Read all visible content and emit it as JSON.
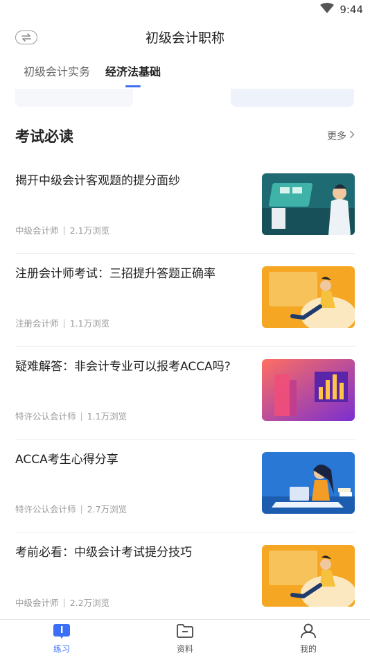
{
  "status": {
    "time": "9:44"
  },
  "header": {
    "title": "初级会计职称"
  },
  "tabs": [
    {
      "label": "初级会计实务",
      "active": false
    },
    {
      "label": "经济法基础",
      "active": true
    }
  ],
  "section": {
    "title": "考试必读",
    "more_label": "更多"
  },
  "articles": [
    {
      "title": "揭开中级会计客观题的提分面纱",
      "category": "中级会计师",
      "views": "2.1万浏览",
      "thumb": "tech"
    },
    {
      "title": "注册会计师考试：三招提升答题正确率",
      "category": "注册会计师",
      "views": "1.1万浏览",
      "thumb": "relax"
    },
    {
      "title": "疑难解答：非会计专业可以报考ACCA吗?",
      "category": "特许公认会计师",
      "views": "1.1万浏览",
      "thumb": "chart"
    },
    {
      "title": "ACCA考生心得分享",
      "category": "特许公认会计师",
      "views": "2.7万浏览",
      "thumb": "study"
    },
    {
      "title": "考前必看：中级会计考试提分技巧",
      "category": "中级会计师",
      "views": "2.2万浏览",
      "thumb": "relax"
    }
  ],
  "bottom_nav": [
    {
      "label": "练习",
      "icon": "practice-icon",
      "active": true
    },
    {
      "label": "资料",
      "icon": "folder-icon",
      "active": false
    },
    {
      "label": "我的",
      "icon": "user-icon",
      "active": false
    }
  ],
  "colors": {
    "accent": "#3b6ff5",
    "muted": "#999999"
  }
}
